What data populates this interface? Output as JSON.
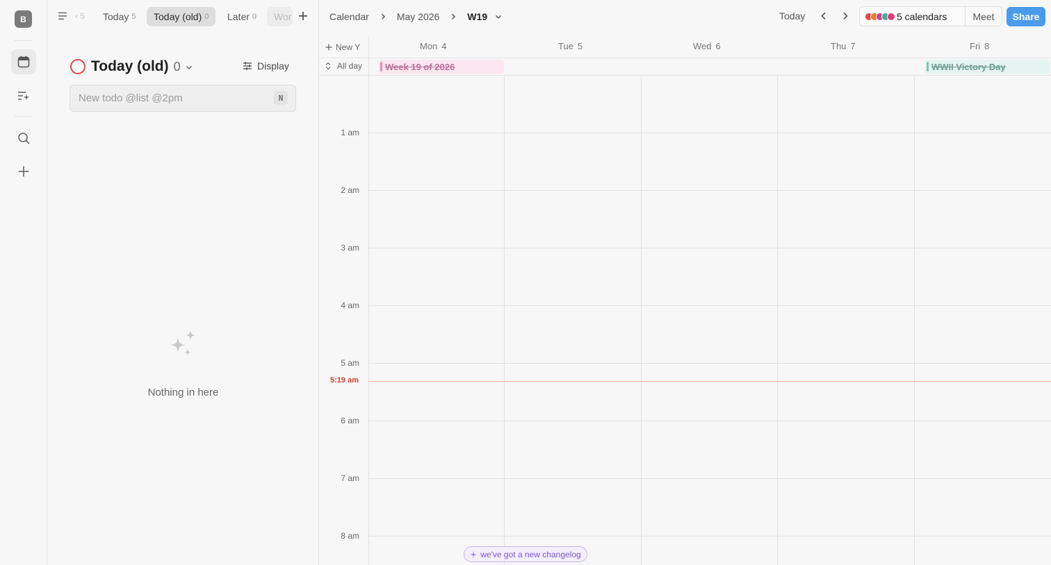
{
  "rail": {
    "avatar_letter": "B",
    "icons": [
      "calendar-icon",
      "ai-list-icon",
      "search-icon",
      "plus-icon"
    ]
  },
  "todo": {
    "prev_tab_count": "5",
    "tabs": [
      {
        "label": "Today",
        "count": "5"
      },
      {
        "label": "Today (old)",
        "count": "0"
      },
      {
        "label": "Later",
        "count": "0"
      },
      {
        "label": "Wor",
        "count": ""
      }
    ],
    "list_title": "Today (old)",
    "list_count": "0",
    "display_label": "Display",
    "new_todo_placeholder": "New todo @list @2pm",
    "new_todo_shortcut": "N",
    "empty_message": "Nothing in here"
  },
  "calendar": {
    "breadcrumb": {
      "root": "Calendar",
      "month": "May 2026",
      "week": "W19"
    },
    "today_label": "Today",
    "calendars_label": "5 calendars",
    "calendar_colors": [
      "#e5493a",
      "#f0772e",
      "#d3408f",
      "#3fb08f",
      "#e8397f"
    ],
    "meet_label": "Meet",
    "share_label": "Share",
    "new_event_label": "New Y",
    "allday_label": "All day",
    "days": [
      {
        "name": "Mon",
        "num": "4"
      },
      {
        "name": "Tue",
        "num": "5"
      },
      {
        "name": "Wed",
        "num": "6"
      },
      {
        "name": "Thu",
        "num": "7"
      },
      {
        "name": "Fri",
        "num": "8"
      }
    ],
    "allday_events": [
      {
        "title": "Week 19 of 2026",
        "day": "Mon 4",
        "color": "#e98cb8",
        "completed": true
      },
      {
        "title": "WWII Victory Day",
        "day": "Fri 8",
        "color": "#7cc7b3",
        "completed": true
      }
    ],
    "hours": [
      "1 am",
      "2 am",
      "3 am",
      "4 am",
      "5 am",
      "6 am",
      "7 am",
      "8 am"
    ],
    "now_time": "5:19 am",
    "changelog_label": "we've got a new changelog"
  }
}
